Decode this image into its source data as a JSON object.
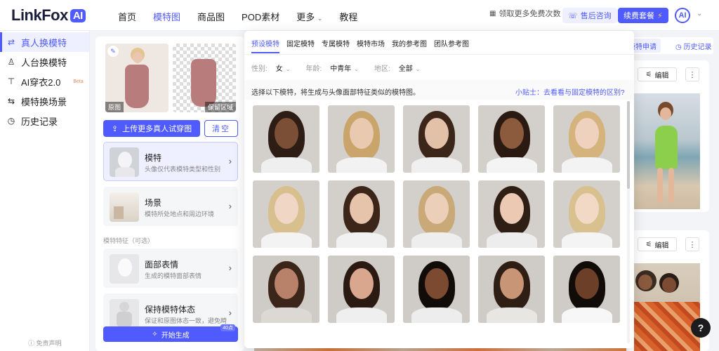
{
  "logo": {
    "text": "LinkFox",
    "badge": "AI"
  },
  "nav": {
    "items": [
      {
        "label": "首页",
        "active": false
      },
      {
        "label": "模特图",
        "active": true
      },
      {
        "label": "商品图",
        "active": false
      },
      {
        "label": "POD素材",
        "active": false
      },
      {
        "label": "更多",
        "active": false
      },
      {
        "label": "教程",
        "active": false
      }
    ]
  },
  "header": {
    "free_text": "领取更多免费次数",
    "after_sales": "售后咨询",
    "renew": "续费套餐",
    "avatar_text": "AI"
  },
  "sidebar": {
    "items": [
      {
        "label": "真人换模特",
        "icon": "person-swap-icon",
        "active": true
      },
      {
        "label": "人台换模特",
        "icon": "mannequin-icon",
        "active": false
      },
      {
        "label": "AI穿衣2.0",
        "icon": "shirt-icon",
        "active": false,
        "badge": "Beta"
      },
      {
        "label": "模特换场景",
        "icon": "scene-swap-icon",
        "active": false
      },
      {
        "label": "历史记录",
        "icon": "history-icon",
        "active": false
      }
    ],
    "disclaimer": "免责声明"
  },
  "left_panel": {
    "original_label": "原图",
    "keep_label": "保留区域",
    "upload_button": "上传更多真人试穿图",
    "clear_button": "清空",
    "cards": [
      {
        "title": "模特",
        "desc": "头像仅代表模特类型和性别"
      },
      {
        "title": "场景",
        "desc": "模特所处地点和周边环境"
      },
      {
        "title": "面部表情",
        "desc": "生成的模特面部表情"
      },
      {
        "title": "保持模特体态",
        "desc": "保证和原图体态一致，避免畸"
      }
    ],
    "section_label": "模特特征（可选）",
    "generate_button": "开始生成",
    "generate_badge": "40点"
  },
  "popover": {
    "tabs": [
      {
        "label": "预设模特",
        "active": true
      },
      {
        "label": "固定模特",
        "active": false
      },
      {
        "label": "专属模特",
        "active": false
      },
      {
        "label": "模特市场",
        "active": false
      },
      {
        "label": "我的参考图",
        "active": false
      },
      {
        "label": "团队参考图",
        "active": false
      }
    ],
    "filters": [
      {
        "label": "性别:",
        "value": "女"
      },
      {
        "label": "年龄:",
        "value": "中青年"
      },
      {
        "label": "地区:",
        "value": "全部"
      }
    ],
    "tip_left": "选择以下模特，将生成与头像面部特征类似的模特图。",
    "tip_right": "小贴士：去看看与固定模特的区别?"
  },
  "right_panel": {
    "apply_button": "模特申请",
    "history_button": "历史记录",
    "edit_label": "编辑"
  },
  "colors": {
    "accent": "#4f5bff"
  }
}
